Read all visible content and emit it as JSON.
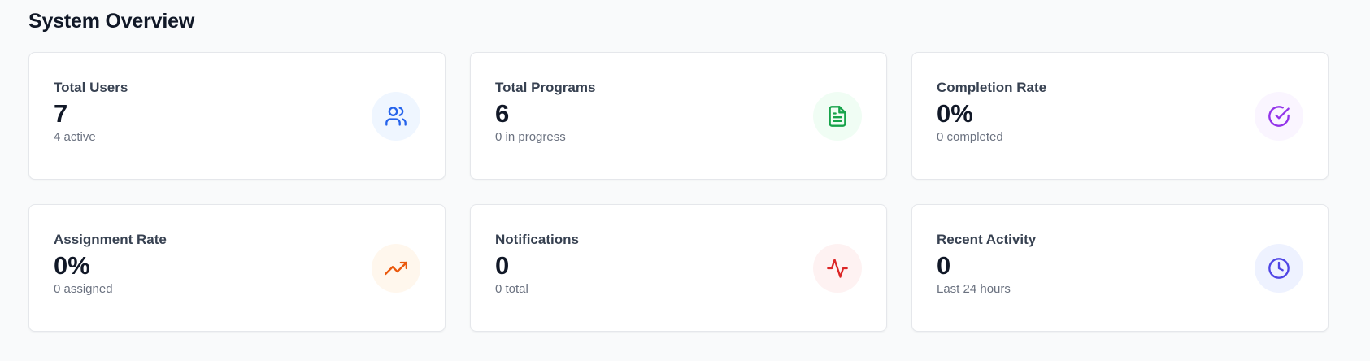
{
  "section": {
    "title": "System Overview"
  },
  "cards": [
    {
      "title": "Total Users",
      "value": "7",
      "subtitle": "4 active",
      "icon": "users-icon",
      "icon_color": "#2563eb",
      "icon_bg": "#eff6ff"
    },
    {
      "title": "Total Programs",
      "value": "6",
      "subtitle": "0 in progress",
      "icon": "document-icon",
      "icon_color": "#16a34a",
      "icon_bg": "#f0fdf4"
    },
    {
      "title": "Completion Rate",
      "value": "0%",
      "subtitle": "0 completed",
      "icon": "check-circle-icon",
      "icon_color": "#9333ea",
      "icon_bg": "#faf5ff"
    },
    {
      "title": "Assignment Rate",
      "value": "0%",
      "subtitle": "0 assigned",
      "icon": "trending-up-icon",
      "icon_color": "#ea580c",
      "icon_bg": "#fff7ed"
    },
    {
      "title": "Notifications",
      "value": "0",
      "subtitle": "0 total",
      "icon": "activity-icon",
      "icon_color": "#dc2626",
      "icon_bg": "#fef2f2"
    },
    {
      "title": "Recent Activity",
      "value": "0",
      "subtitle": "Last 24 hours",
      "icon": "clock-icon",
      "icon_color": "#4f46e5",
      "icon_bg": "#eef2ff"
    }
  ]
}
